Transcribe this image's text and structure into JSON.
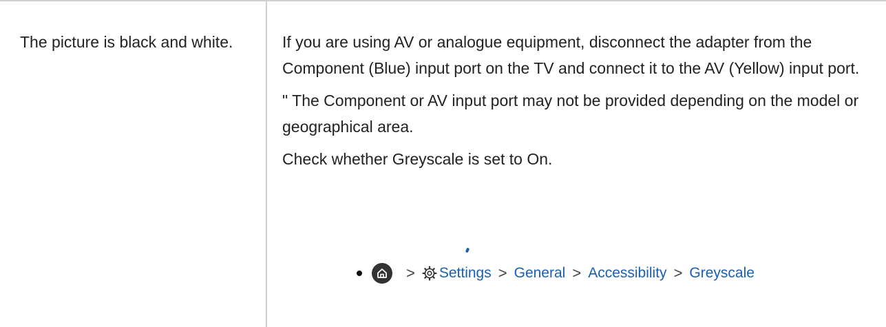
{
  "symptom": "The picture is black and white.",
  "solution": {
    "paragraph1": "If you are using AV or analogue equipment, disconnect the adapter from the Component (Blue) input port on the TV and connect it to the AV (Yellow) input port.",
    "note": "\" The Component or AV input port may not be provided depending on the model or geographical area.",
    "check": "Check whether Greyscale is set to On."
  },
  "menu_path": {
    "icons": [
      "home-icon",
      "gear-icon",
      "chevron-right-icon"
    ],
    "items": [
      "Settings",
      "General",
      "Accessibility",
      "Greyscale"
    ],
    "separator": ">"
  },
  "colors": {
    "link": "#1a5fb4",
    "border": "#cfcfcf",
    "text": "#222222"
  }
}
